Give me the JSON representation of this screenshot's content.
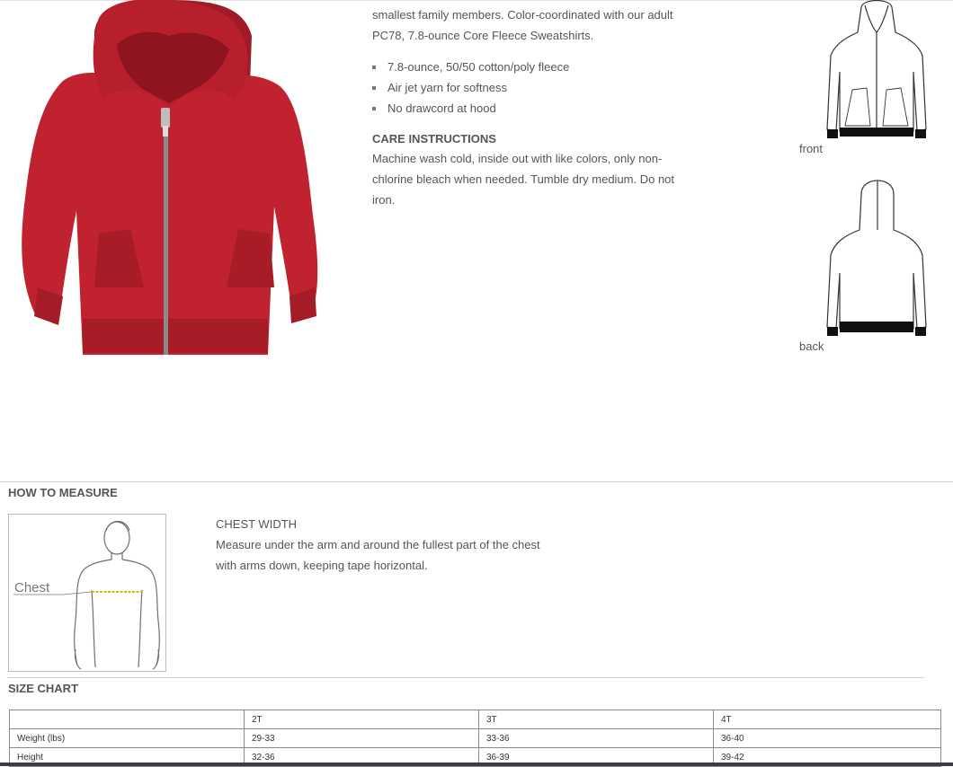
{
  "description": {
    "intro": "smallest family members. Color-coordinated with our adult PC78, 7.8-ounce Core Fleece Sweatshirts.",
    "features": [
      "7.8-ounce, 50/50 cotton/poly fleece",
      "Air jet yarn for softness",
      "No drawcord at hood"
    ],
    "care_heading": "CARE INSTRUCTIONS",
    "care_text": "Machine wash cold, inside out with like colors, only non-chlorine bleach when needed. Tumble dry medium. Do not iron."
  },
  "product": {
    "color": "#b5202e"
  },
  "flats": {
    "front_label": "front",
    "back_label": "back"
  },
  "measure": {
    "title": "HOW TO MEASURE",
    "diagram_label": "Chest",
    "heading": "CHEST WIDTH",
    "line1": "Measure under the arm and around the fullest part of the chest",
    "line2": "with arms down, keeping tape horizontal."
  },
  "size_chart": {
    "title": "SIZE CHART",
    "columns": [
      "",
      "2T",
      "3T",
      "4T"
    ],
    "rows": [
      {
        "label": "Weight (lbs)",
        "values": [
          "29-33",
          "33-36",
          "36-40"
        ]
      },
      {
        "label": "Height",
        "values": [
          "32-36",
          "36-39",
          "39-42"
        ]
      }
    ]
  }
}
